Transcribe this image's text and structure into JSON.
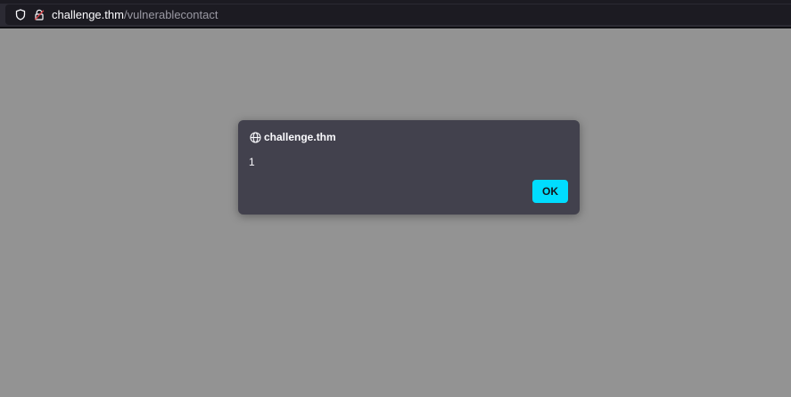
{
  "urlbar": {
    "domain": "challenge.thm",
    "path": "/vulnerablecontact",
    "security_icon": "shield-icon",
    "lock_icon": "lock-warning-icon"
  },
  "dialog": {
    "icon": "globe-icon",
    "title": "challenge.thm",
    "message": "1",
    "ok_label": "OK"
  },
  "colors": {
    "page_overlay": "#939393",
    "toolbar": "#2b2a33",
    "urlbar": "#1c1b22",
    "dialog_bg": "#42414d",
    "accent": "#00ddff",
    "lock_warning": "#e5484d"
  }
}
